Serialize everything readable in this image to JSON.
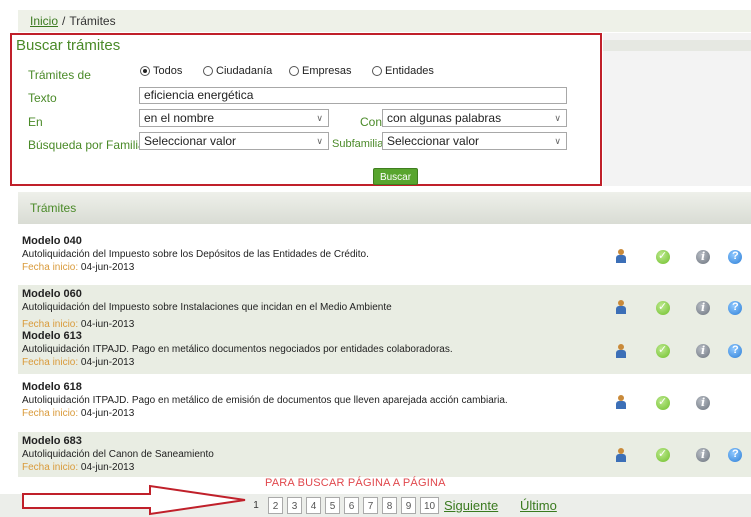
{
  "breadcrumb": {
    "home": "Inicio",
    "separator": "/",
    "current": "Trámites"
  },
  "search": {
    "title": "Buscar trámites",
    "tramites_label": "Trámites de",
    "radios": [
      {
        "label": "Todos",
        "selected": true
      },
      {
        "label": "Ciudadanía",
        "selected": false
      },
      {
        "label": "Empresas",
        "selected": false
      },
      {
        "label": "Entidades",
        "selected": false
      }
    ],
    "texto_label": "Texto",
    "texto_value": "eficiencia energética",
    "en_label": "En",
    "en_value": "en el nombre",
    "con_label": "Con",
    "con_value": "con algunas palabras",
    "familia_label": "Búsqueda por Familia",
    "familia_value": "Seleccionar valor",
    "subfamilia_label": "Subfamilia",
    "subfamilia_value": "Seleccionar valor",
    "button": "Buscar"
  },
  "results": {
    "header": "Trámites",
    "date_key": "Fecha inicio:",
    "items": [
      {
        "title": "Modelo 040",
        "desc": "Autoliquidación del Impuesto sobre los Depósitos de las Entidades de Crédito.",
        "date": "04-jun-2013",
        "help": true
      },
      {
        "title": "Modelo 060",
        "desc": "Autoliquidación del Impuesto sobre Instalaciones que incidan en el Medio Ambiente",
        "date": "04-jun-2013",
        "help": true
      },
      {
        "title": "Modelo 613",
        "desc": "Autoliquidación ITPAJD. Pago en metálico documentos negociados por entidades colaboradoras.",
        "date": "04-jun-2013",
        "help": true
      },
      {
        "title": "Modelo 618",
        "desc": "Autoliquidación ITPAJD. Pago en metálico de emisión de documentos que lleven aparejada acción cambiaria.",
        "date": "04-jun-2013",
        "help": false
      },
      {
        "title": "Modelo 683",
        "desc": "Autoliquidación del Canon de Saneamiento",
        "date": "04-jun-2013",
        "help": true
      }
    ]
  },
  "pagination": {
    "annotation": "PARA BUSCAR PÁGINA A PÁGINA",
    "prev": "«",
    "pages": [
      "1",
      "2",
      "3",
      "4",
      "5",
      "6",
      "7",
      "8",
      "9",
      "10"
    ],
    "current": "1",
    "next": "Siguiente",
    "last": "Último"
  },
  "colors": {
    "accent_green": "#4a8a28",
    "button_green": "#58a52e",
    "annotation_red": "#c0202a"
  }
}
